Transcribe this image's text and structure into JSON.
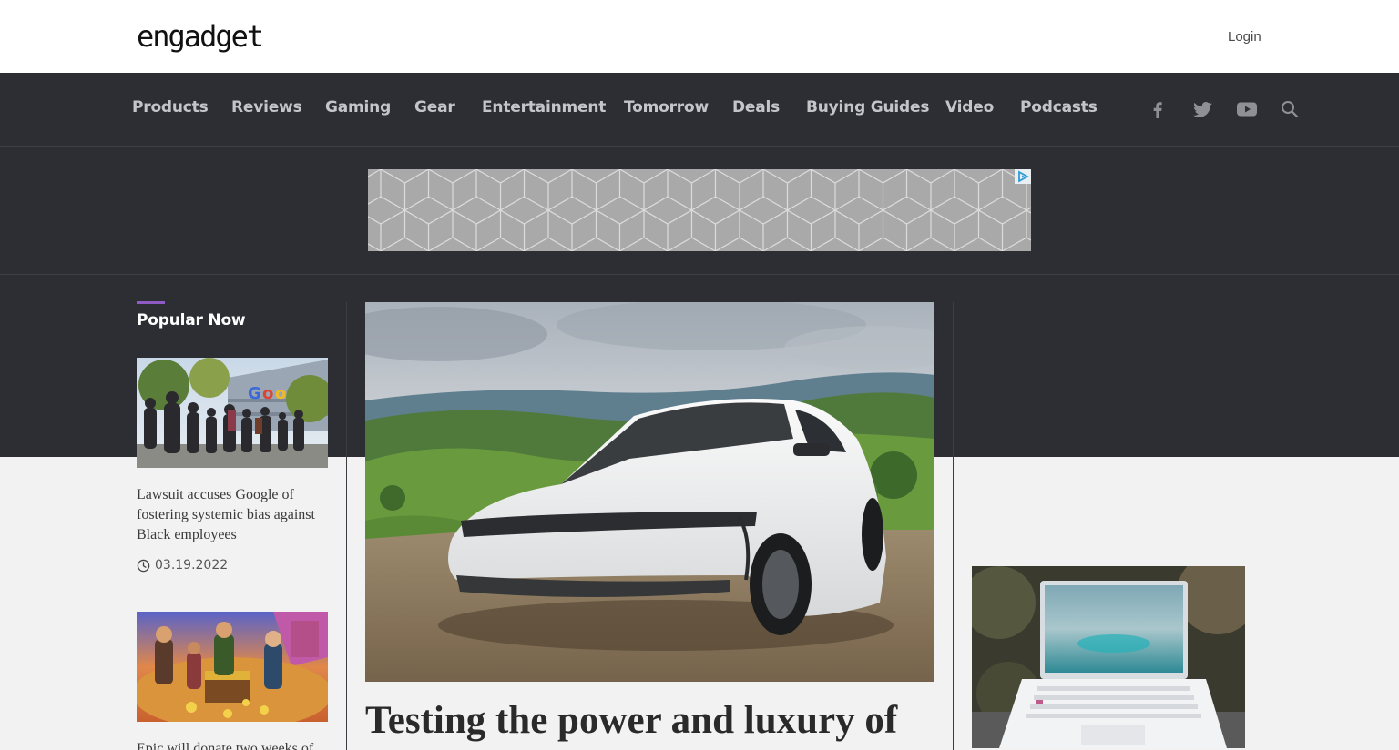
{
  "header": {
    "logo_text": "engadget",
    "login_label": "Login"
  },
  "nav": {
    "items": [
      "Products",
      "Reviews",
      "Gaming",
      "Gear",
      "Entertainment",
      "Tomorrow",
      "Deals",
      "Buying Guides",
      "Video",
      "Podcasts"
    ],
    "icons": [
      "facebook-icon",
      "twitter-icon",
      "youtube-icon",
      "search-icon"
    ]
  },
  "ad": {
    "choice_icon": "adchoices-icon"
  },
  "popular": {
    "heading": "Popular Now",
    "accent_color": "#8e5bc4",
    "articles": [
      {
        "headline": "Lawsuit accuses Google of fostering systemic bias against Black employees",
        "date": "03.19.2022"
      },
      {
        "headline": "Epic will donate two weeks of"
      }
    ]
  },
  "hero": {
    "title": "Testing the power and luxury of"
  },
  "colors": {
    "dark_band": "#2d2e33",
    "page_bg": "#f2f2f2",
    "nav_text": "#c4c5c9"
  }
}
